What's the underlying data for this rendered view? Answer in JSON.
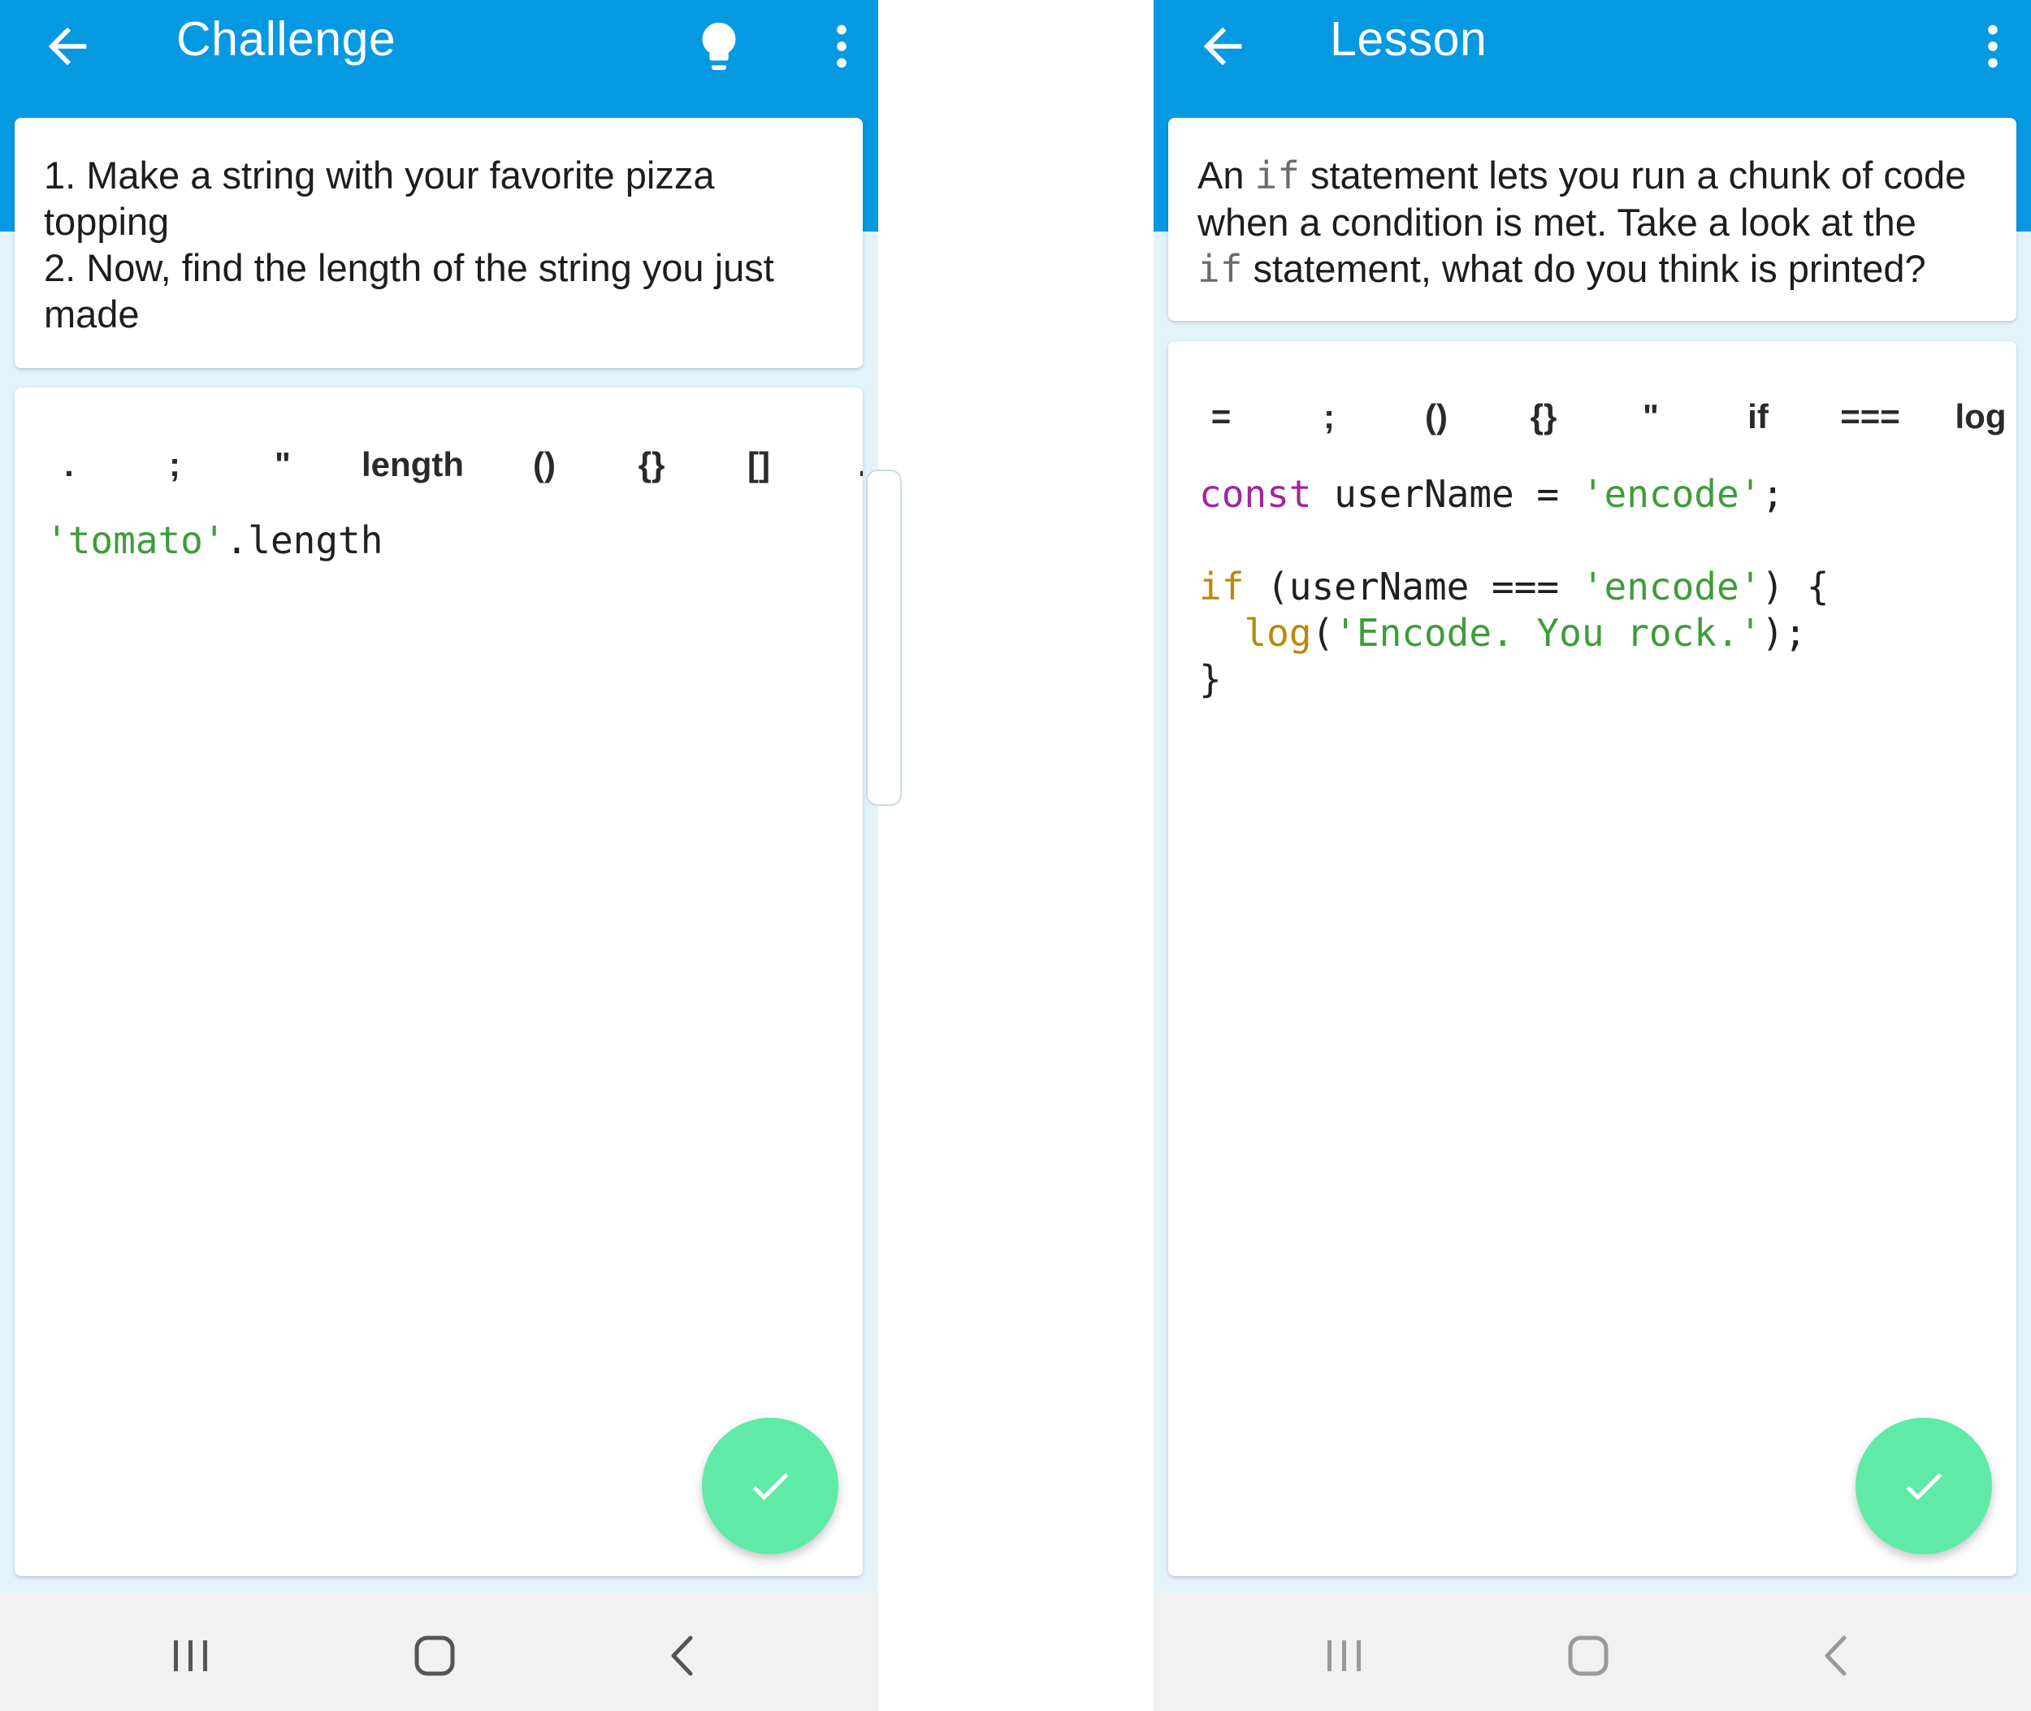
{
  "left_screen": {
    "title": "Challenge",
    "icons": {
      "back": "arrow-left-icon",
      "hint": "lightbulb-icon",
      "menu": "more-vert-icon"
    },
    "instructions": [
      "1. Make a string with your favorite pizza",
      "topping",
      "2. Now, find the length of the string you just",
      "made"
    ],
    "tokens": [
      ".",
      ";",
      "\"",
      "length",
      "()",
      "{}",
      "[]",
      "."
    ],
    "code": {
      "string": "'tomato'",
      "rest": ".length"
    },
    "fab_icon": "checkmark-icon"
  },
  "right_screen": {
    "title": "Lesson",
    "icons": {
      "back": "arrow-left-icon",
      "menu": "more-vert-icon"
    },
    "description": {
      "part1": "An ",
      "kw1": "if",
      "part2": " statement lets you run a chunk of code",
      "line2": "when a condition is met. Take a look at the",
      "kw2": "if",
      "part3": " statement, what do you think is printed?"
    },
    "tokens": [
      "=",
      ";",
      "()",
      "{}",
      "\"",
      "if",
      "===",
      "log"
    ],
    "code": {
      "l1_kw": "const",
      "l1_mid": " userName = ",
      "l1_str": "'encode'",
      "l1_end": ";",
      "l3_kw": "if",
      "l3_mid": " (userName === ",
      "l3_str": "'encode'",
      "l3_end": ") {",
      "l4_indent": "  ",
      "l4_fn": "log",
      "l4_open": "(",
      "l4_str": "'Encode. You rock.'",
      "l4_end": ");",
      "l5": "}"
    },
    "fab_icon": "checkmark-icon"
  },
  "system_nav": {
    "recents": "recents-icon",
    "home": "home-icon",
    "back": "back-chevron-icon"
  },
  "colors": {
    "app_bar": "#0599e2",
    "background": "#e3f3fc",
    "fab": "#5feaa8",
    "string": "#3e9c3a",
    "keyword": "#a3259b",
    "control": "#b78a0a"
  }
}
